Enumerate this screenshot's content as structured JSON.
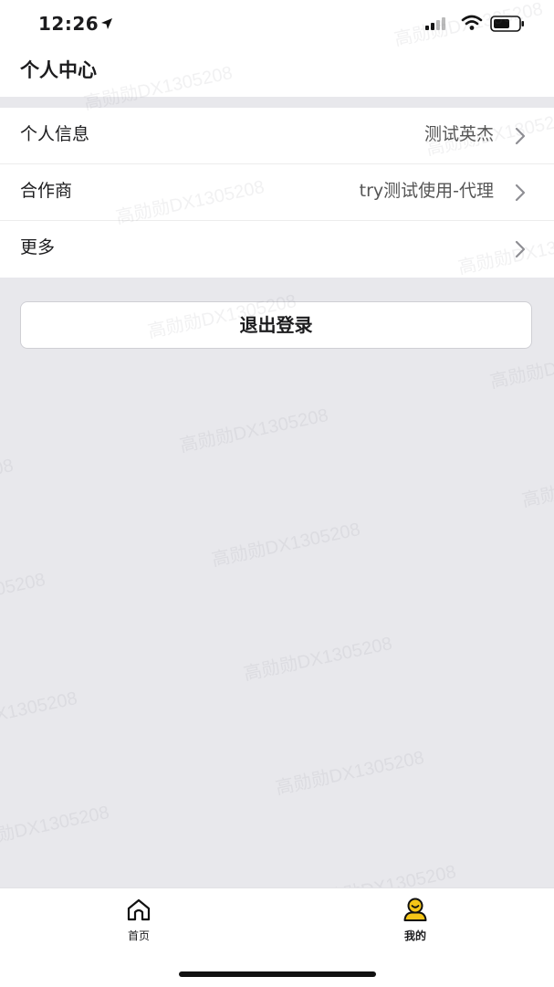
{
  "status_bar": {
    "time": "12:26"
  },
  "header": {
    "title": "个人中心"
  },
  "list": {
    "items": [
      {
        "label": "个人信息",
        "value": "测试英杰"
      },
      {
        "label": "合作商",
        "value": "try测试使用-代理"
      },
      {
        "label": "更多",
        "value": ""
      }
    ]
  },
  "actions": {
    "logout_label": "退出登录"
  },
  "tab_bar": {
    "tabs": [
      {
        "label": "首页",
        "icon": "home-icon",
        "active": false
      },
      {
        "label": "我的",
        "icon": "profile-icon",
        "active": true
      }
    ]
  },
  "watermark": {
    "text": "高勋勋DX1305208"
  },
  "colors": {
    "background": "#e8e8ec",
    "surface": "#ffffff",
    "accent": "#f5c518"
  }
}
